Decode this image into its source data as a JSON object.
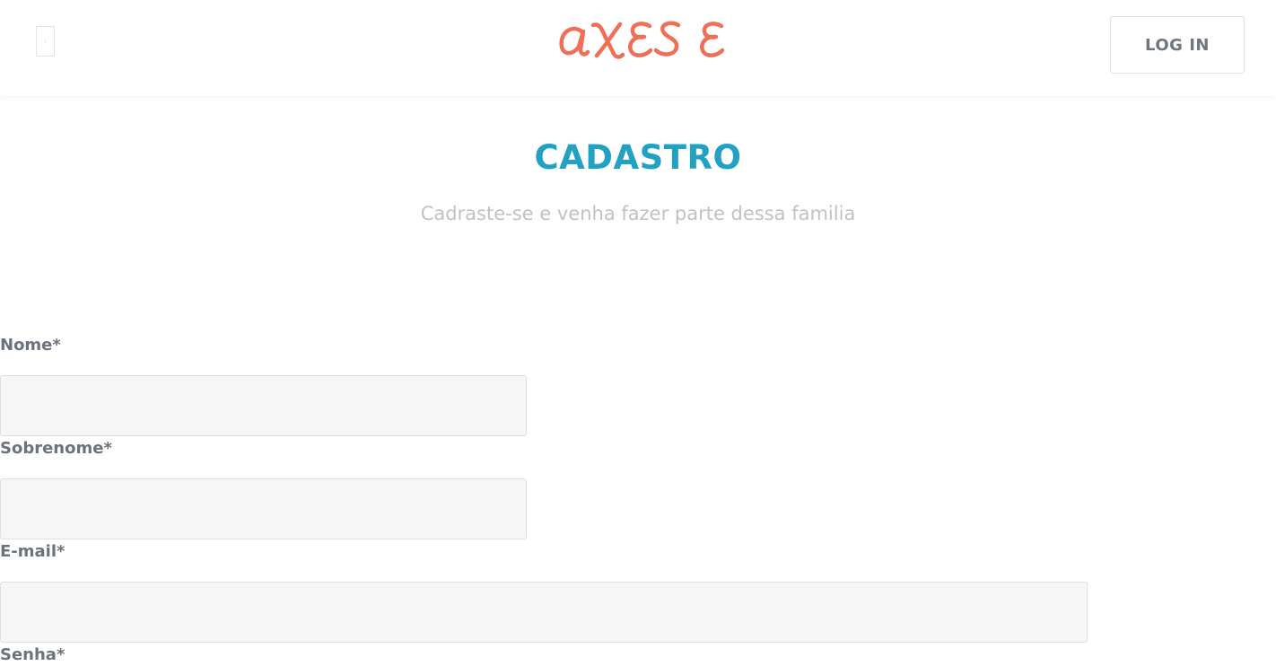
{
  "header": {
    "menu_icon": "menu-icon",
    "logo_text": "AXESE",
    "logo_color": "#ef7058",
    "login_label": "LOG IN"
  },
  "main": {
    "title": "CADASTRO",
    "title_color": "#23a1c2",
    "subtitle": "Cadraste-se e venha fazer parte dessa familia"
  },
  "form": {
    "first_name_label": "Nome*",
    "first_name_value": "",
    "last_name_label": "Sobrenome*",
    "last_name_value": "",
    "email_label": "E-mail*",
    "email_value": "",
    "password_label": "Senha*"
  }
}
